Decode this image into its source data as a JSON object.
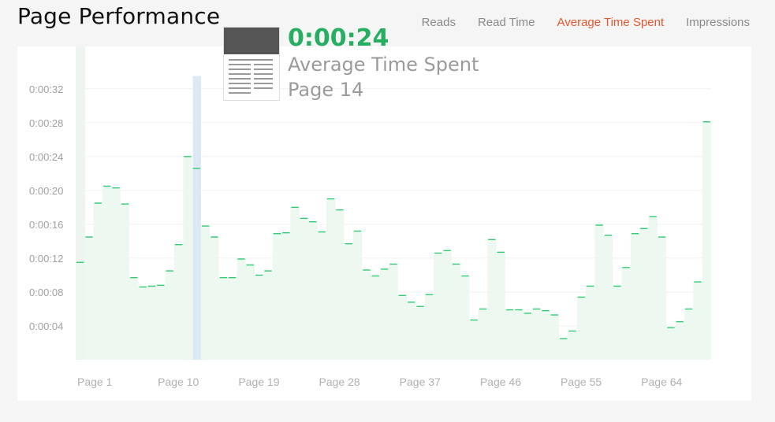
{
  "page": {
    "title": "Page Performance"
  },
  "tabs": [
    {
      "label": "Reads",
      "active": false
    },
    {
      "label": "Read Time",
      "active": false
    },
    {
      "label": "Average Time Spent",
      "active": true
    },
    {
      "label": "Impressions",
      "active": false
    }
  ],
  "tooltip": {
    "value": "0:00:24",
    "metric": "Average Time Spent",
    "page": "Page 14"
  },
  "colors": {
    "accent": "#e4572e",
    "line": "#2ecc71",
    "value": "#27ae60",
    "fill": "#eaf7ef",
    "highlight": "#dbe9f5"
  },
  "chart_data": {
    "type": "bar",
    "style": "step line with light area fill",
    "ylabel": "",
    "xlabel": "",
    "ylim": [
      0,
      37
    ],
    "y_tick_values": [
      4,
      8,
      12,
      16,
      20,
      24,
      28,
      32
    ],
    "y_tick_labels": [
      "0:00:04",
      "0:00:08",
      "0:00:12",
      "0:00:16",
      "0:00:20",
      "0:00:24",
      "0:00:28",
      "0:00:32"
    ],
    "x_tick_labels": [
      {
        "page": 1,
        "label": "Page 1"
      },
      {
        "page": 10,
        "label": "Page 10"
      },
      {
        "page": 19,
        "label": "Page 19"
      },
      {
        "page": 28,
        "label": "Page 28"
      },
      {
        "page": 37,
        "label": "Page 37"
      },
      {
        "page": 46,
        "label": "Page 46"
      },
      {
        "page": 55,
        "label": "Page 55"
      },
      {
        "page": 64,
        "label": "Page 64"
      }
    ],
    "highlighted_page": 14,
    "pages": [
      1,
      2,
      3,
      4,
      5,
      6,
      7,
      8,
      9,
      10,
      11,
      12,
      13,
      14,
      15,
      16,
      17,
      18,
      19,
      20,
      21,
      22,
      23,
      24,
      25,
      26,
      27,
      28,
      29,
      30,
      31,
      32,
      33,
      34,
      35,
      36,
      37,
      38,
      39,
      40,
      41,
      42,
      43,
      44,
      45,
      46,
      47,
      48,
      49,
      50,
      51,
      52,
      53,
      54,
      55,
      56,
      57,
      58,
      59,
      60,
      61,
      62,
      63,
      64,
      65,
      66,
      67,
      68,
      69,
      70,
      71
    ],
    "values_seconds": [
      11.5,
      14.5,
      18.5,
      20.5,
      20.3,
      18.4,
      9.7,
      8.6,
      8.7,
      8.8,
      10.5,
      13.6,
      24,
      22.6,
      15.8,
      14.5,
      9.7,
      9.7,
      11.9,
      11.2,
      10.0,
      10.5,
      14.9,
      15.0,
      18,
      16.7,
      16.3,
      15.1,
      19,
      17.7,
      13.7,
      15.2,
      10.6,
      9.9,
      10.7,
      11.3,
      7.6,
      6.8,
      6.3,
      7.7,
      12.6,
      12.9,
      11.3,
      9.9,
      4.7,
      6.0,
      14.2,
      12.7,
      5.9,
      5.9,
      5.5,
      6.0,
      5.8,
      5.3,
      2.5,
      3.4,
      7.4,
      8.7,
      15.9,
      14.7,
      8.7,
      10.9,
      14.9,
      15.5,
      16.9,
      14.5,
      3.8,
      4.5,
      6.0,
      9.2,
      28.1
    ]
  }
}
